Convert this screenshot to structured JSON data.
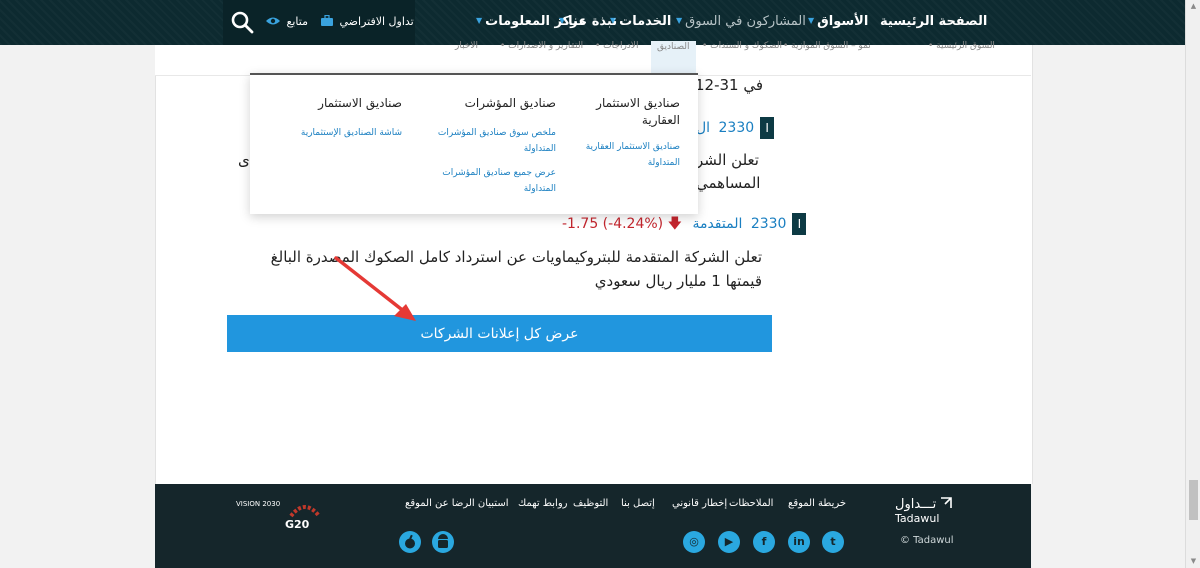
{
  "nav": {
    "home": "الصفحة الرئيسية",
    "markets": "الأسواق",
    "participants": "المشاركون في السوق",
    "services": "الخدمات",
    "about": "نبذة عنا",
    "info_center": "مركز المعلومات",
    "virtual_trading": "تداول الافتراضي",
    "follow": "متابع"
  },
  "breadcrumb": {
    "items": [
      "السوق الرئيسية",
      "نمو – السوق الموازية",
      "الصكوك و السندات",
      "الصناديق",
      "الادراجات",
      "التقارير و الاصدارات",
      "الاخبار"
    ]
  },
  "announcements": {
    "date_fragment": "في 31-12",
    "item1": {
      "code": "2330",
      "company_partial": "ال",
      "body_line1": "تعلن الشر",
      "body_line2": "المساهمي",
      "body_overflow": "ى"
    },
    "item2": {
      "code": "2330",
      "company": "المتقدمة",
      "change": "-1.75 (-4.24%)",
      "body": "تعلن الشركة المتقدمة للبتروكيماويات عن استرداد كامل الصكوك المصدرة البالغ قيمتها 1 مليار ريال سعودي"
    },
    "view_all_label": "عرض كل إعلانات الشركات"
  },
  "mega_menu": {
    "col1": {
      "title": "صناديق الاستثمار العقارية",
      "links": [
        "صناديق الاستثمار العقارية المتداولة"
      ]
    },
    "col2": {
      "title": "صناديق المؤشرات",
      "links": [
        "ملخص سوق صناديق المؤشرات المتداولة",
        "عرض جميع صناديق المؤشرات المتداولة"
      ]
    },
    "col3": {
      "title": "صناديق الاستثمار",
      "links": [
        "شاشة الصناديق الإستثمارية"
      ]
    }
  },
  "footer": {
    "links": [
      "خريطة الموقع",
      "الملاحظات",
      "إخطار قانوني",
      "إتصل بنا",
      "التوظيف",
      "روابط تهمك",
      "استبيان الرضا عن الموقع"
    ],
    "copyright": "© Tadawul",
    "logo_ar": "تـــداول",
    "logo_en": "Tadawul",
    "vision_logo_text": "VISION 2030",
    "g20_logo_text": "G20"
  },
  "colors": {
    "topbar": "#0d2a30",
    "accent": "#2196de",
    "link": "#1a7fc1",
    "negative": "#c4262e",
    "footer": "#15262b",
    "arrow": "#e53935"
  }
}
